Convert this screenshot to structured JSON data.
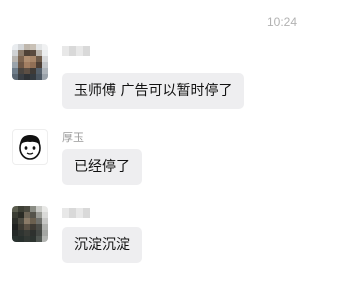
{
  "chat": {
    "timestamp": "10:24",
    "messages": [
      {
        "sender": "",
        "text": "玉师傅 广告可以暂时停了",
        "avatar_icon": "pixelated-user-avatar-icon"
      },
      {
        "sender": "厚玉",
        "text": "已经停了",
        "avatar_icon": "cartoon-face-avatar-icon"
      },
      {
        "sender": "",
        "text": "沉淀沉淀",
        "avatar_icon": "pixelated-user-avatar-icon"
      }
    ]
  }
}
